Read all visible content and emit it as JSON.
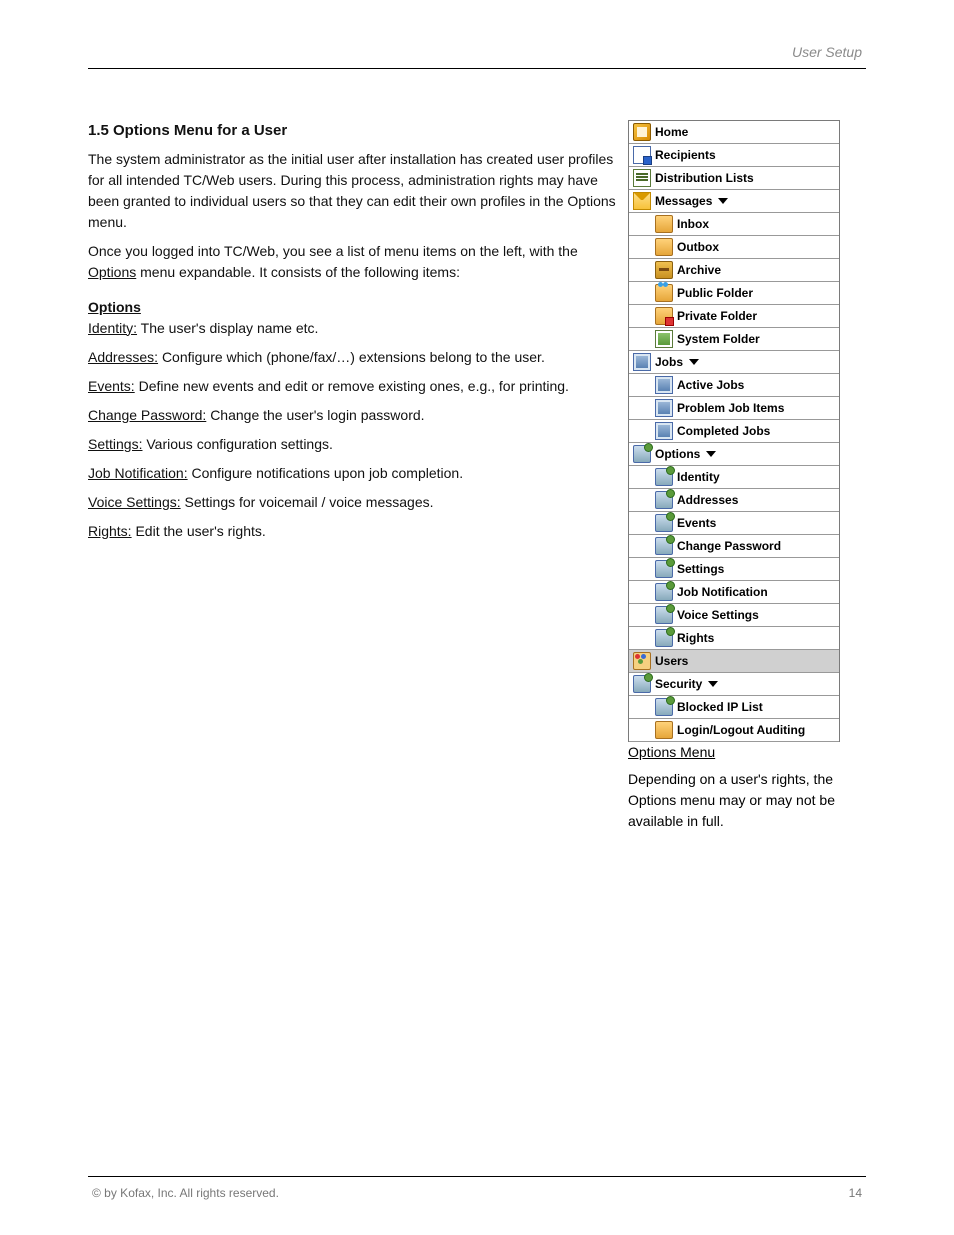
{
  "header": {
    "right": "User Setup"
  },
  "footer": {
    "left": "© by Kofax, Inc. All rights reserved.",
    "right": "14"
  },
  "explain": {
    "heading": "1.5 Options Menu for a User",
    "para1": "The system administrator as the initial user after installation has created user profiles for all intended TC/Web users. During this process, administration rights may have been granted to individual users so that they can edit their own profiles in the Options menu.",
    "para2": "Once you logged into TC/Web, you see a list of menu items on the left, with the ",
    "para2_link": "Options",
    "para2_tail": " menu expandable. It consists of the following items:",
    "optionsHeading": "Options",
    "items": {
      "identity": {
        "label": "Identity:",
        "text": "The user's display name etc."
      },
      "addresses": {
        "label": "Addresses:",
        "text": "Configure which (phone/fax/…) extensions belong to the user."
      },
      "events": {
        "label": "Events:",
        "text": "Define new events and edit or remove existing ones, e.g., for printing."
      },
      "password": {
        "label": "Change Password:",
        "text": "Change the user's login password."
      },
      "settings": {
        "label": "Settings:",
        "text": "Various configuration settings."
      },
      "jobnotif": {
        "label": "Job Notification:",
        "text": "Configure notifications upon job completion."
      },
      "voice": {
        "label": "Voice Settings:",
        "text": "Settings for voicemail / voice messages."
      },
      "rights": {
        "label": "Rights:",
        "text": "Edit the user's rights."
      }
    }
  },
  "menu": {
    "home": "Home",
    "recipients": "Recipients",
    "distlists": "Distribution Lists",
    "messages": "Messages",
    "inbox": "Inbox",
    "outbox": "Outbox",
    "archive": "Archive",
    "publicFolder": "Public Folder",
    "privateFolder": "Private Folder",
    "systemFolder": "System Folder",
    "jobs": "Jobs",
    "activeJobs": "Active Jobs",
    "problemJobs": "Problem Job Items",
    "completedJobs": "Completed Jobs",
    "options": "Options",
    "identity": "Identity",
    "addresses": "Addresses",
    "events": "Events",
    "changePassword": "Change Password",
    "settings": "Settings",
    "jobNotification": "Job Notification",
    "voiceSettings": "Voice Settings",
    "rights": "Rights",
    "users": "Users",
    "security": "Security",
    "blockedIp": "Blocked IP List",
    "loginAudit": "Login/Logout Auditing"
  },
  "belowMenu": {
    "title": "Options Menu",
    "text": "Depending on a user's rights, the Options menu may or may not be available in full."
  }
}
